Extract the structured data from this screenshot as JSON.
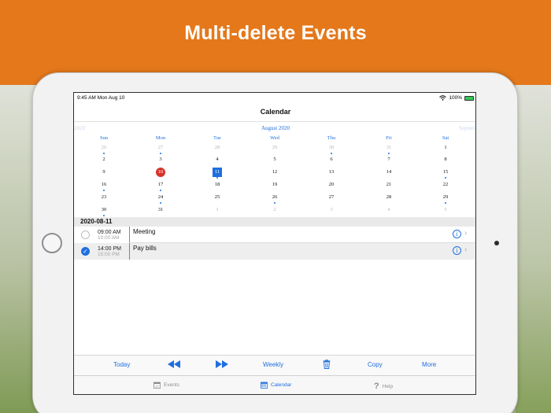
{
  "banner": {
    "title": "Multi-delete Events",
    "color": "#e4781b"
  },
  "status_bar": {
    "time": "9:45 AM",
    "date": "Mon Aug 10",
    "battery": "100%"
  },
  "nav": {
    "title": "Calendar"
  },
  "calendar": {
    "prev_label": "2020",
    "month_label": "August 2020",
    "next_label": "Septem",
    "weekdays": [
      "Sun",
      "Mon",
      "Tue",
      "Wed",
      "Thu",
      "Fri",
      "Sat"
    ],
    "weeks": [
      [
        "26",
        "27",
        "28",
        "29",
        "30",
        "31",
        "1"
      ],
      [
        "2",
        "3",
        "4",
        "5",
        "6",
        "7",
        "8"
      ],
      [
        "9",
        "10",
        "11",
        "12",
        "13",
        "14",
        "15"
      ],
      [
        "16",
        "17",
        "18",
        "19",
        "20",
        "21",
        "22"
      ],
      [
        "23",
        "24",
        "25",
        "26",
        "27",
        "28",
        "29"
      ],
      [
        "30",
        "31",
        "1",
        "2",
        "3",
        "4",
        "5"
      ]
    ],
    "today": "10",
    "selected": "11",
    "accent": "#1f6fe0",
    "today_color": "#d6342b"
  },
  "day_list": {
    "date": "2020-08-11",
    "events": [
      {
        "start": "09:00 AM",
        "end": "10:00 AM",
        "title": "Meeting",
        "checked": false,
        "color": "#c15dd1"
      },
      {
        "start": "14:00 PM",
        "end": "15:00 PM",
        "title": "Pay bills",
        "checked": true,
        "color": "#2f9ad8"
      }
    ]
  },
  "toolbar": {
    "today": "Today",
    "weekly": "Weekly",
    "copy": "Copy",
    "more": "More"
  },
  "tabs": {
    "events": "Events",
    "calendar": "Calendar",
    "help": "Help"
  }
}
